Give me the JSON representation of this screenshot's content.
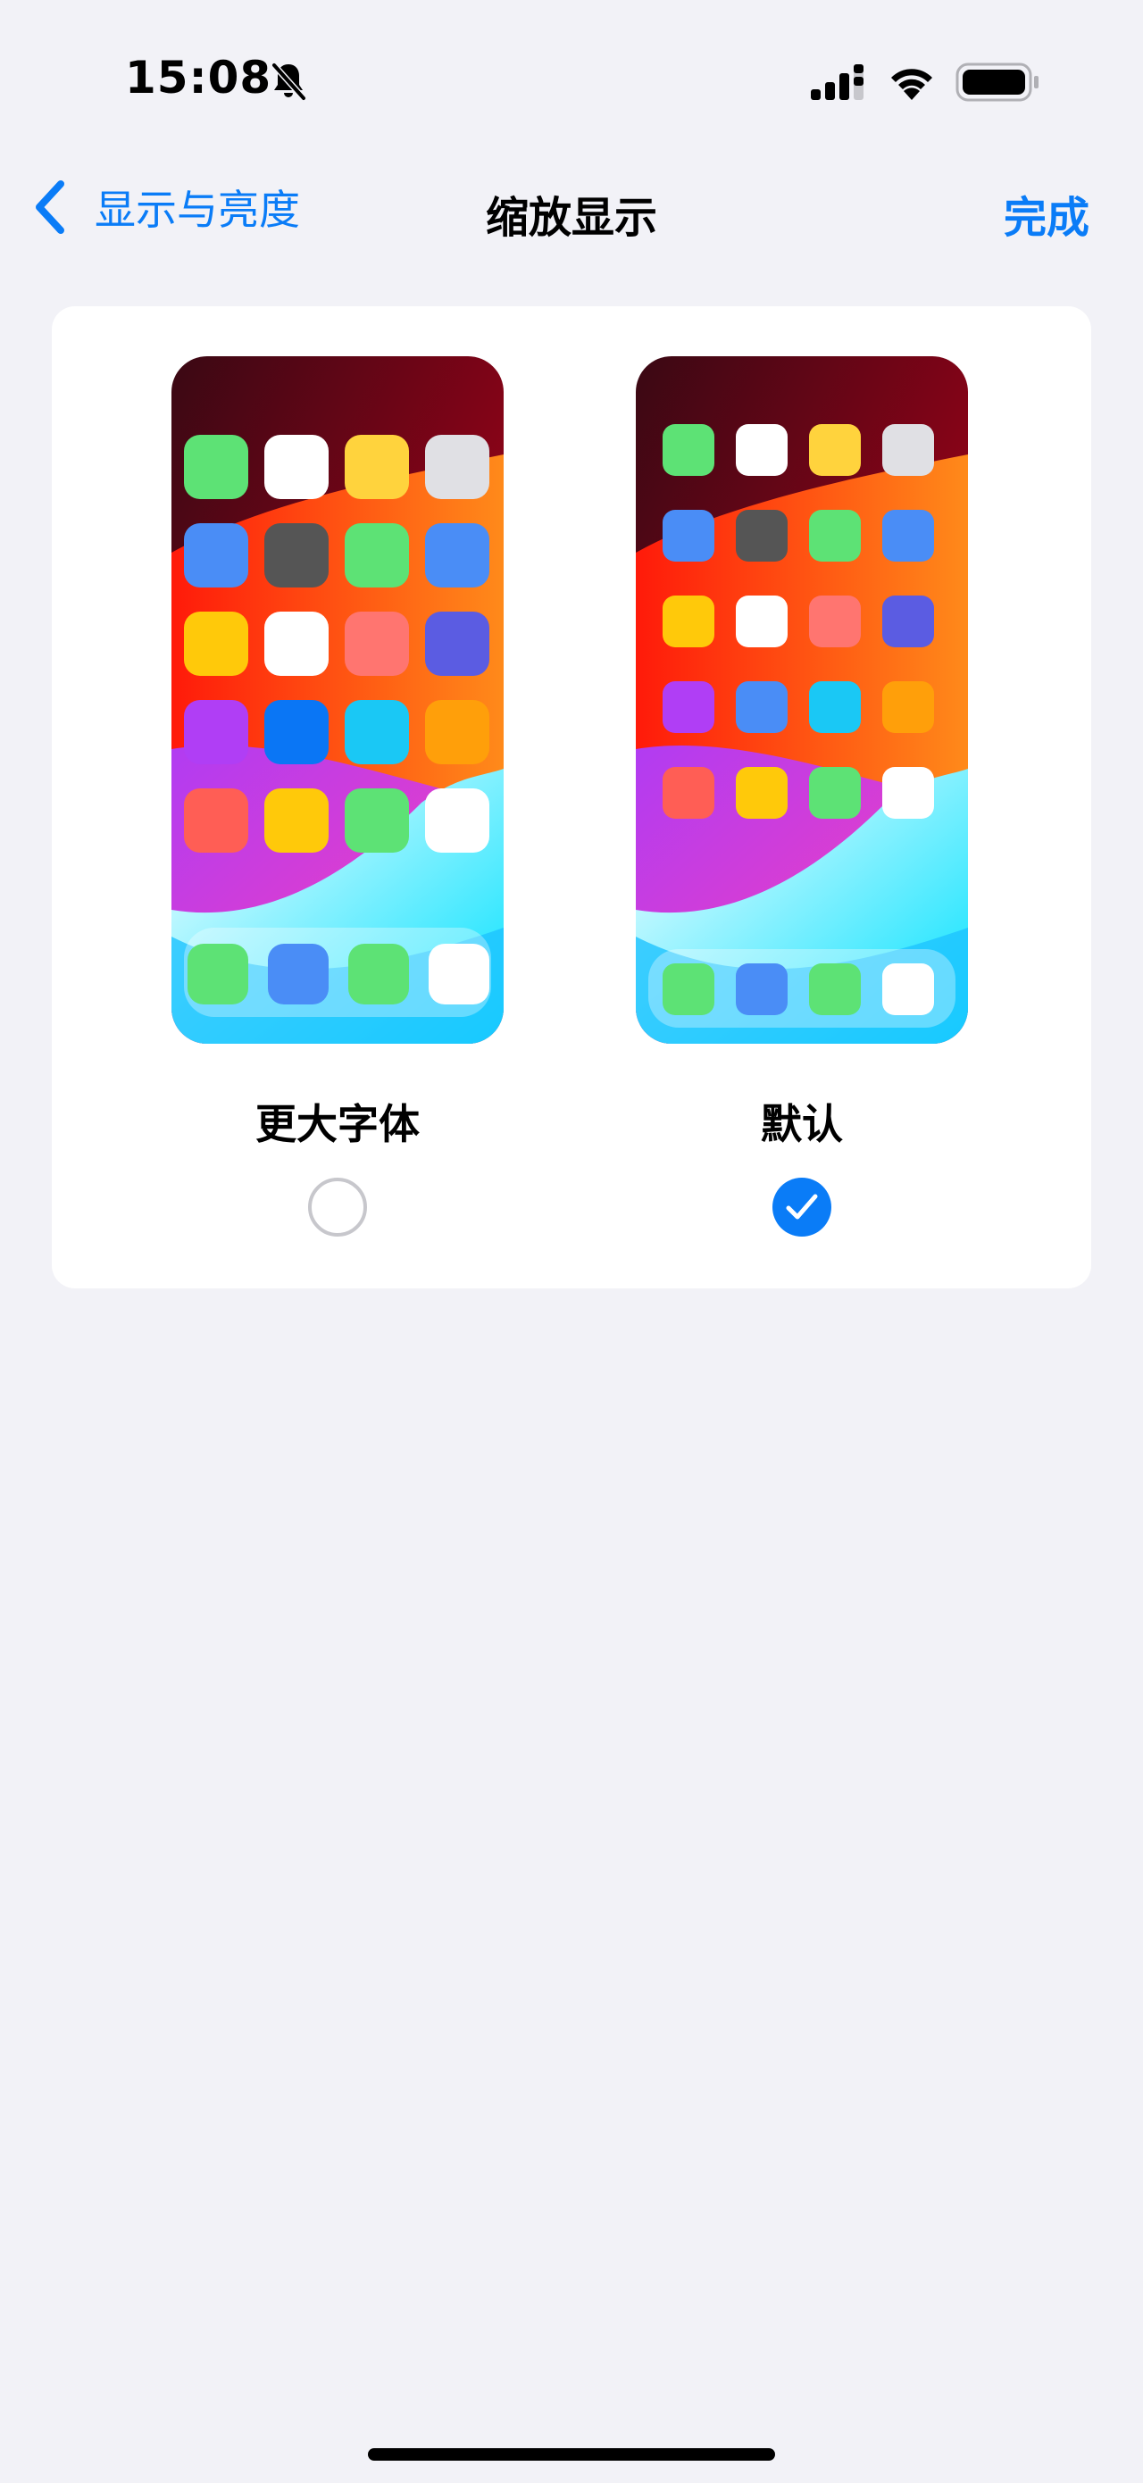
{
  "status_bar": {
    "time": "15:08",
    "icons": [
      "bell-slash-icon",
      "cellular-signal-icon",
      "wifi-icon",
      "battery-icon"
    ]
  },
  "nav": {
    "back_label": "显示与亮度",
    "title": "缩放显示",
    "done_label": "完成"
  },
  "colors": {
    "accent": "#0a7cf7",
    "background": "#f2f2f7",
    "card": "#ffffff"
  },
  "options": [
    {
      "label": "更大字体",
      "selected": false,
      "icon_rows": [
        [
          "#5de275",
          "#ffffff",
          "#ffd33d",
          "#e0e0e4"
        ],
        [
          "#4a8df6",
          "#555555",
          "#5de275",
          "#4a8df6"
        ],
        [
          "#ffc90a",
          "#ffffff",
          "#ff7570",
          "#5b5ce2"
        ],
        [
          "#b03ef5",
          "#0a76f5",
          "#1ac8f5",
          "#ff9f0a"
        ],
        [
          "#ff5e55",
          "#ffc90a",
          "#5de275",
          "#ffffff"
        ]
      ],
      "dock": [
        "#5de275",
        "#4a8df6",
        "#5de275",
        "#ffffff"
      ]
    },
    {
      "label": "默认",
      "selected": true,
      "icon_rows": [
        [
          "#5de275",
          "#ffffff",
          "#ffd33d",
          "#e0e0e4"
        ],
        [
          "#4a8df6",
          "#555555",
          "#5de275",
          "#4a8df6"
        ],
        [
          "#ffc90a",
          "#ffffff",
          "#ff7570",
          "#5b5ce2"
        ],
        [
          "#b03ef5",
          "#4a8df6",
          "#1ac8f5",
          "#ff9f0a"
        ],
        [
          "#ff5e55",
          "#ffc90a",
          "#5de275",
          "#ffffff"
        ]
      ],
      "dock": [
        "#5de275",
        "#4a8df6",
        "#5de275",
        "#ffffff"
      ]
    }
  ]
}
